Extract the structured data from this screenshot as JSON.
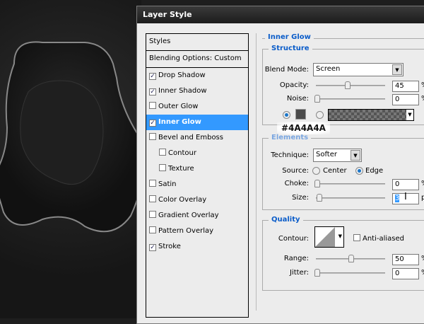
{
  "dialog": {
    "title": "Layer Style"
  },
  "styles_list": {
    "header": "Styles",
    "blending": "Blending Options: Custom",
    "items": [
      {
        "label": "Drop Shadow",
        "checked": true,
        "sub": false
      },
      {
        "label": "Inner Shadow",
        "checked": true,
        "sub": false
      },
      {
        "label": "Outer Glow",
        "checked": false,
        "sub": false
      },
      {
        "label": "Inner Glow",
        "checked": true,
        "sub": false,
        "selected": true
      },
      {
        "label": "Bevel and Emboss",
        "checked": false,
        "sub": false
      },
      {
        "label": "Contour",
        "checked": false,
        "sub": true
      },
      {
        "label": "Texture",
        "checked": false,
        "sub": true
      },
      {
        "label": "Satin",
        "checked": false,
        "sub": false
      },
      {
        "label": "Color Overlay",
        "checked": false,
        "sub": false
      },
      {
        "label": "Gradient Overlay",
        "checked": false,
        "sub": false
      },
      {
        "label": "Pattern Overlay",
        "checked": false,
        "sub": false
      },
      {
        "label": "Stroke",
        "checked": true,
        "sub": false
      }
    ]
  },
  "panel": {
    "title": "Inner Glow",
    "structure": {
      "title": "Structure",
      "blend_label": "Blend Mode:",
      "blend_value": "Screen",
      "opacity_label": "Opacity:",
      "opacity": "45",
      "opacity_unit": "%",
      "noise_label": "Noise:",
      "noise": "0",
      "noise_unit": "%",
      "color": "#4A4A4A"
    },
    "elements": {
      "title": "Elements",
      "technique_label": "Technique:",
      "technique": "Softer",
      "source_label": "Source:",
      "center": "Center",
      "edge": "Edge",
      "source_selected": "Edge",
      "choke_label": "Choke:",
      "choke": "0",
      "choke_unit": "%",
      "size_label": "Size:",
      "size": "3",
      "size_unit": "px"
    },
    "quality": {
      "title": "Quality",
      "contour_label": "Contour:",
      "anti_aliased": "Anti-aliased",
      "anti_aliased_checked": false,
      "range_label": "Range:",
      "range": "50",
      "range_unit": "%",
      "jitter_label": "Jitter:",
      "jitter": "0",
      "jitter_unit": "%"
    }
  },
  "tooltip": {
    "text": "#4A4A4A"
  }
}
